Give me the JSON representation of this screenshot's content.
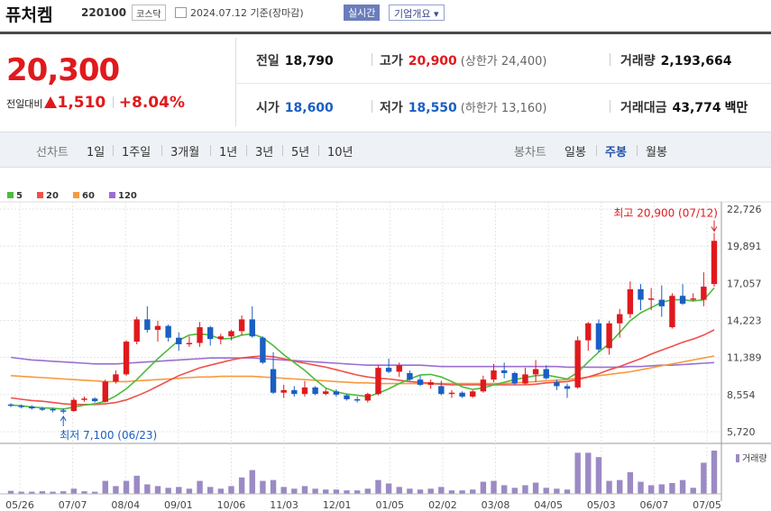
{
  "header": {
    "name": "퓨처켐",
    "code": "220100",
    "market": "코스닥",
    "date": "2024.07.12 기준(장마감)",
    "realtime": "실시간",
    "company": "기업개요 ▾"
  },
  "quote": {
    "price": "20,300",
    "change_label": "전일대비",
    "change": "1,510",
    "change_pct": "+8.04%",
    "prev_label": "전일",
    "prev": "18,790",
    "high_label": "고가",
    "high": "20,900",
    "upper_limit": "(상한가 24,400)",
    "volume_label": "거래량",
    "volume": "2,193,664",
    "open_label": "시가",
    "open": "18,600",
    "low_label": "저가",
    "low": "18,550",
    "lower_limit": "(하한가 13,160)",
    "amount_label": "거래대금",
    "amount": "43,774",
    "amount_unit": "백만"
  },
  "toolbar": {
    "line_caption": "선차트",
    "periods": [
      "1일",
      "1주일",
      "3개월",
      "1년",
      "3년",
      "5년",
      "10년"
    ],
    "candle_caption": "봉차트",
    "candles": [
      "일봉",
      "주봉",
      "월봉"
    ],
    "selected_candle": "주봉"
  },
  "colors": {
    "up": "#e0191d",
    "down": "#1a5fc2",
    "ma5": "#4cbb3c",
    "ma20": "#f0504a",
    "ma60": "#f79a3e",
    "ma120": "#9a6fd1",
    "volume": "#9b8ac4"
  },
  "chart_data": {
    "type": "candlestick",
    "ylim": [
      5720,
      22726
    ],
    "y_ticks": [
      "22,726",
      "19,891",
      "17,057",
      "14,223",
      "11,389",
      "8,554",
      "5,720"
    ],
    "x_ticks": [
      "05/26",
      "07/07",
      "08/04",
      "09/01",
      "10/06",
      "11/03",
      "12/01",
      "01/05",
      "02/02",
      "03/08",
      "04/05",
      "05/03",
      "06/07",
      "07/05"
    ],
    "legend": [
      {
        "name": "5",
        "color": "#4cbb3c"
      },
      {
        "name": "20",
        "color": "#f0504a"
      },
      {
        "name": "60",
        "color": "#f79a3e"
      },
      {
        "name": "120",
        "color": "#9a6fd1"
      }
    ],
    "annotation_high": "최고 20,900 (07/12)",
    "annotation_low": "최저 7,100 (06/23)",
    "volume_label": "거래량",
    "candles": [
      [
        7800,
        7900,
        7600,
        7700
      ],
      [
        7700,
        7800,
        7500,
        7650
      ],
      [
        7650,
        7750,
        7400,
        7500
      ],
      [
        7500,
        7600,
        7300,
        7450
      ],
      [
        7450,
        7550,
        7200,
        7350
      ],
      [
        7350,
        7500,
        7100,
        7300
      ],
      [
        7300,
        8300,
        7250,
        8150
      ],
      [
        8150,
        8400,
        8000,
        8250
      ],
      [
        8250,
        8350,
        7950,
        8050
      ],
      [
        8000,
        9700,
        7950,
        9550
      ],
      [
        9550,
        10400,
        9400,
        10100
      ],
      [
        10100,
        12700,
        10000,
        12600
      ],
      [
        12600,
        14500,
        12400,
        14300
      ],
      [
        14300,
        15300,
        13300,
        13500
      ],
      [
        13500,
        14200,
        12600,
        13800
      ],
      [
        13800,
        13900,
        12600,
        12900
      ],
      [
        12900,
        13300,
        11900,
        12400
      ],
      [
        12400,
        13000,
        12200,
        12500
      ],
      [
        12500,
        14100,
        12200,
        13700
      ],
      [
        13700,
        13800,
        12300,
        12800
      ],
      [
        12800,
        13200,
        12400,
        13000
      ],
      [
        13000,
        13500,
        12700,
        13400
      ],
      [
        13400,
        14600,
        13100,
        14300
      ],
      [
        14300,
        15300,
        12900,
        13000
      ],
      [
        12900,
        13000,
        10900,
        11000
      ],
      [
        10500,
        11800,
        8600,
        8700
      ],
      [
        8700,
        9300,
        8300,
        8900
      ],
      [
        8900,
        9200,
        8400,
        8600
      ],
      [
        8600,
        9600,
        8400,
        9100
      ],
      [
        9100,
        9200,
        8500,
        8600
      ],
      [
        8600,
        9000,
        8500,
        8800
      ],
      [
        8800,
        8950,
        8400,
        8550
      ],
      [
        8500,
        8600,
        8100,
        8200
      ],
      [
        8200,
        8400,
        7950,
        8100
      ],
      [
        8100,
        8700,
        7950,
        8600
      ],
      [
        8600,
        10800,
        8500,
        10600
      ],
      [
        10600,
        11300,
        10200,
        10300
      ],
      [
        10300,
        11000,
        9900,
        10800
      ],
      [
        10200,
        10400,
        9600,
        9700
      ],
      [
        9700,
        10000,
        9200,
        9300
      ],
      [
        9300,
        9700,
        9000,
        9500
      ],
      [
        9200,
        9600,
        8500,
        8600
      ],
      [
        8600,
        8900,
        8300,
        8700
      ],
      [
        8700,
        8800,
        8300,
        8400
      ],
      [
        8400,
        8900,
        8300,
        8800
      ],
      [
        8800,
        10000,
        8700,
        9700
      ],
      [
        9700,
        10900,
        9500,
        10400
      ],
      [
        10400,
        11000,
        9800,
        10200
      ],
      [
        10200,
        10300,
        9300,
        9400
      ],
      [
        9400,
        10600,
        9300,
        10100
      ],
      [
        10100,
        11200,
        9500,
        10500
      ],
      [
        10500,
        10800,
        9700,
        9800
      ],
      [
        9500,
        9700,
        8900,
        9200
      ],
      [
        9200,
        9400,
        8300,
        9000
      ],
      [
        9100,
        13000,
        9000,
        12700
      ],
      [
        12700,
        14100,
        11900,
        14000
      ],
      [
        14000,
        14300,
        11800,
        12000
      ],
      [
        12100,
        14200,
        11600,
        14000
      ],
      [
        14000,
        15100,
        12900,
        14700
      ],
      [
        14700,
        17200,
        14400,
        16600
      ],
      [
        16600,
        17000,
        15000,
        15800
      ],
      [
        15900,
        16700,
        15000,
        15900
      ],
      [
        15800,
        16900,
        14500,
        15300
      ],
      [
        13700,
        16300,
        13600,
        16100
      ],
      [
        16100,
        17000,
        15400,
        15500
      ],
      [
        15800,
        16300,
        15700,
        15900
      ],
      [
        15800,
        17900,
        15300,
        16800
      ],
      [
        17000,
        20900,
        16800,
        20300
      ]
    ],
    "ma5": [
      7750,
      7700,
      7600,
      7550,
      7500,
      7450,
      7600,
      7750,
      7850,
      8050,
      8450,
      9000,
      9700,
      10500,
      11300,
      12000,
      12700,
      13100,
      13200,
      13100,
      12800,
      12850,
      13100,
      13200,
      12900,
      12300,
      11600,
      11000,
      10400,
      9700,
      9050,
      8750,
      8600,
      8500,
      8400,
      8650,
      9000,
      9400,
      9750,
      10050,
      10100,
      9900,
      9550,
      9150,
      8950,
      9050,
      9300,
      9500,
      9700,
      9850,
      10000,
      10050,
      9900,
      9750,
      10250,
      11050,
      11800,
      12450,
      13300,
      14200,
      14800,
      15200,
      15600,
      15800,
      15800,
      15700,
      15800,
      16700
    ],
    "ma20": [
      8300,
      8200,
      8100,
      8050,
      7950,
      7850,
      7800,
      7800,
      7800,
      7850,
      7950,
      8150,
      8450,
      8800,
      9200,
      9600,
      10000,
      10300,
      10600,
      10800,
      11000,
      11200,
      11350,
      11450,
      11500,
      11450,
      11300,
      11100,
      10950,
      10800,
      10650,
      10450,
      10250,
      10050,
      9900,
      9800,
      9750,
      9650,
      9550,
      9500,
      9400,
      9350,
      9300,
      9300,
      9300,
      9300,
      9300,
      9300,
      9300,
      9300,
      9350,
      9450,
      9500,
      9550,
      9700,
      9900,
      10150,
      10450,
      10700,
      11000,
      11300,
      11650,
      11950,
      12250,
      12550,
      12800,
      13100,
      13500
    ],
    "ma60": [
      10000,
      9950,
      9900,
      9850,
      9800,
      9750,
      9700,
      9650,
      9600,
      9550,
      9550,
      9550,
      9600,
      9650,
      9700,
      9750,
      9800,
      9850,
      9900,
      9900,
      9950,
      9950,
      9950,
      9950,
      9900,
      9850,
      9800,
      9750,
      9700,
      9650,
      9600,
      9550,
      9500,
      9450,
      9450,
      9400,
      9400,
      9400,
      9400,
      9400,
      9400,
      9400,
      9400,
      9400,
      9400,
      9400,
      9400,
      9400,
      9450,
      9500,
      9550,
      9600,
      9650,
      9700,
      9800,
      9900,
      10000,
      10100,
      10200,
      10300,
      10450,
      10600,
      10750,
      10900,
      11050,
      11200,
      11350,
      11500
    ],
    "ma120": [
      11400,
      11300,
      11200,
      11150,
      11100,
      11050,
      11000,
      10950,
      10900,
      10900,
      10900,
      10950,
      11000,
      11050,
      11100,
      11150,
      11200,
      11250,
      11300,
      11350,
      11350,
      11350,
      11350,
      11350,
      11300,
      11250,
      11200,
      11150,
      11100,
      11050,
      11000,
      10950,
      10900,
      10850,
      10800,
      10800,
      10800,
      10800,
      10800,
      10800,
      10750,
      10700,
      10700,
      10700,
      10700,
      10700,
      10700,
      10700,
      10700,
      10700,
      10700,
      10700,
      10700,
      10650,
      10650,
      10650,
      10650,
      10650,
      10650,
      10700,
      10700,
      10750,
      10800,
      10800,
      10850,
      10900,
      10950,
      11000
    ],
    "volume": [
      0.07,
      0.05,
      0.05,
      0.06,
      0.05,
      0.06,
      0.12,
      0.06,
      0.05,
      0.3,
      0.18,
      0.3,
      0.42,
      0.22,
      0.18,
      0.14,
      0.16,
      0.12,
      0.3,
      0.16,
      0.12,
      0.18,
      0.38,
      0.55,
      0.3,
      0.32,
      0.16,
      0.12,
      0.18,
      0.12,
      0.1,
      0.1,
      0.08,
      0.08,
      0.12,
      0.32,
      0.24,
      0.16,
      0.12,
      0.1,
      0.12,
      0.16,
      0.08,
      0.08,
      0.1,
      0.28,
      0.3,
      0.2,
      0.14,
      0.2,
      0.26,
      0.14,
      0.12,
      0.1,
      0.95,
      0.95,
      0.85,
      0.3,
      0.32,
      0.5,
      0.28,
      0.2,
      0.22,
      0.25,
      0.32,
      0.14,
      0.72,
      1.0
    ]
  }
}
